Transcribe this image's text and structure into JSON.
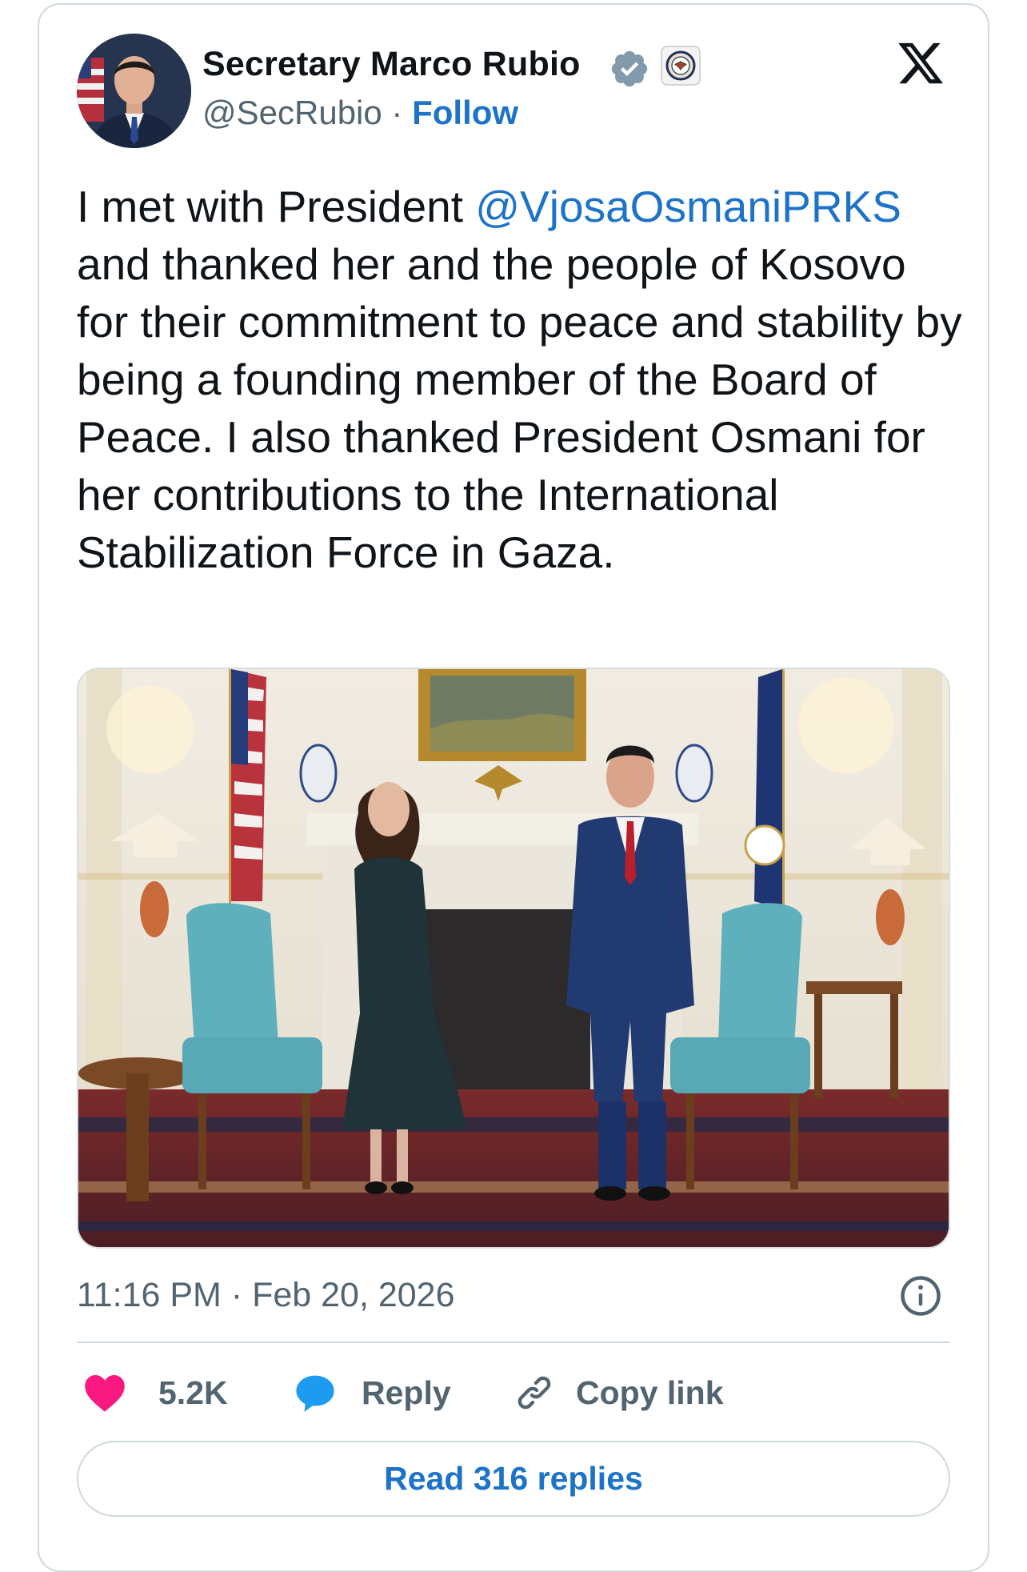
{
  "author": {
    "display_name": "Secretary Marco Rubio",
    "handle": "@SecRubio",
    "separator": "·",
    "follow_label": "Follow"
  },
  "tweet": {
    "text_before": "I met with President ",
    "mention": "@VjosaOsmaniPRKS",
    "text_after": " and thanked her and the people of Kosovo for their commitment to peace and stability by being a founding member of the Board of Peace. I also thanked President Osmani for her contributions to the International Stabilization Force in Gaza.",
    "timestamp": "11:16 PM · Feb 20, 2026"
  },
  "actions": {
    "like_count": "5.2K",
    "reply_label": "Reply",
    "copy_link_label": "Copy link"
  },
  "footer": {
    "read_replies_label": "Read 316 replies"
  },
  "colors": {
    "link_blue": "#1d73c9",
    "verified_gray": "#829aab",
    "heart_pink": "#f91880",
    "reply_blue": "#1d9bf0",
    "chair_teal": "#5fb0bd"
  },
  "icons": [
    "verified-badge-icon",
    "state-dept-seal-icon",
    "x-logo-icon",
    "info-icon",
    "heart-icon",
    "reply-bubble-icon",
    "link-icon"
  ]
}
